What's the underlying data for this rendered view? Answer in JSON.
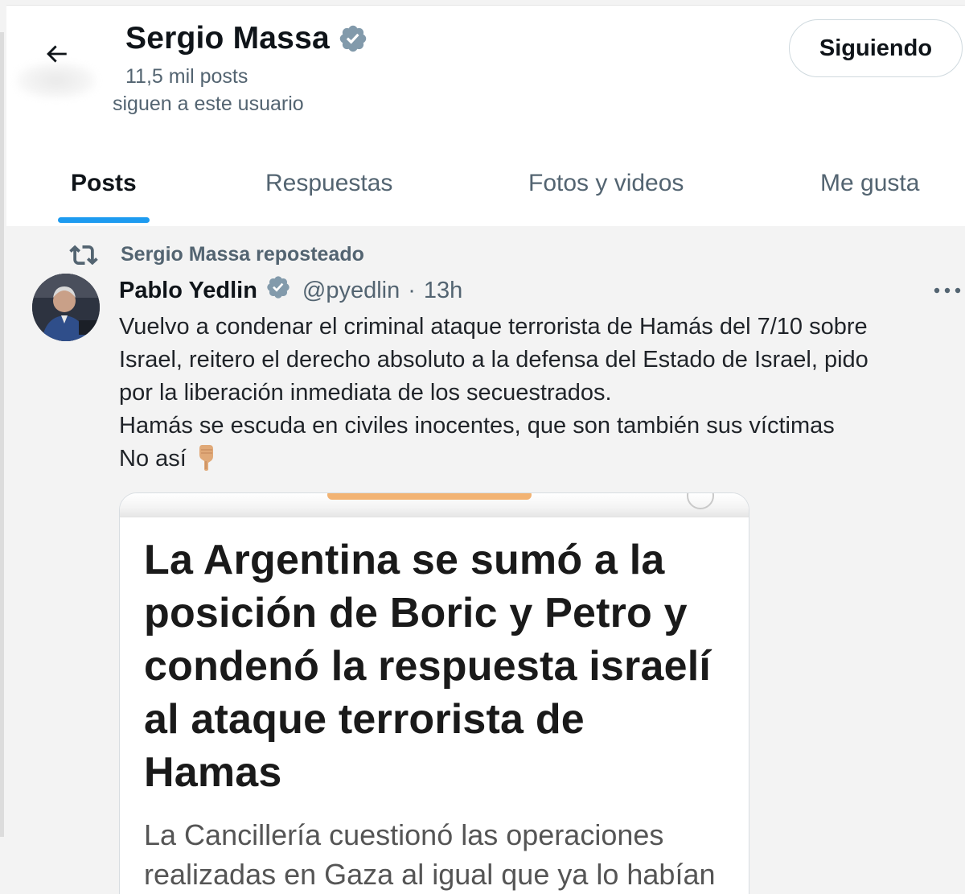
{
  "header": {
    "name": "Sergio Massa",
    "post_count": "11,5 mil posts",
    "followers_note": "siguen a este usuario",
    "follow_button_label": "Siguiendo"
  },
  "tabs": [
    {
      "label": "Posts",
      "active": true
    },
    {
      "label": "Respuestas",
      "active": false
    },
    {
      "label": "Fotos y videos",
      "active": false
    },
    {
      "label": "Me gusta",
      "active": false
    }
  ],
  "post": {
    "repost_label": "Sergio Massa reposteado",
    "author": {
      "name": "Pablo Yedlin",
      "handle": "@pyedlin",
      "separator": "·",
      "time": "13h"
    },
    "body_lines": [
      "Vuelvo a condenar el criminal ataque terrorista de Hamás del 7/10 sobre",
      "Israel, reitero el derecho absoluto a la defensa del Estado de Israel, pido",
      "por la liberación inmediata de los secuestrados.",
      "Hamás se escuda en civiles inocentes, que son también sus víctimas",
      "No así"
    ],
    "media": {
      "headline_lines": [
        "La Argentina se sumó a la",
        "posición de Boric y Petro y",
        "condenó la respuesta israelí",
        "al ataque terrorista de",
        "Hamas"
      ],
      "subhead_lines": [
        "La Cancillería cuestionó las operaciones",
        "realizadas en Gaza al igual que ya lo habían"
      ]
    }
  },
  "colors": {
    "accent": "#1d9bf0",
    "verified_badge": "#829aab",
    "secondary_text": "#536471",
    "background": "#f3f3f3"
  },
  "icons": [
    "back-arrow-icon",
    "verified-badge-icon",
    "repost-icon",
    "more-icon",
    "pointing-down-emoji"
  ]
}
